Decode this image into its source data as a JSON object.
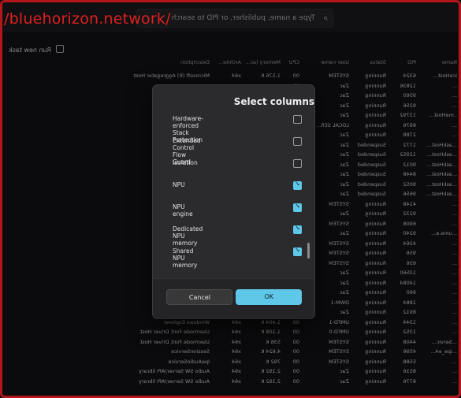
{
  "watermark": "/bluehorizon.network/",
  "search": {
    "placeholder": "Type a name, publisher, or PID to search"
  },
  "toolbar": {
    "run_new_task": "Run new task"
  },
  "columns": [
    "Name",
    "PID",
    "Status",
    "User name",
    "CPU",
    "Memory (ac...",
    "Archite...",
    "Description"
  ],
  "rows": [
    [
      "iceHost...",
      "6324",
      "Running",
      "SYSTEM",
      "00",
      "1,576 K",
      "x64",
      "Microsoft (R) Aggregator Host"
    ],
    [
      "...",
      "12836",
      "Running",
      "Zac",
      "00",
      "",
      "",
      ""
    ],
    [
      "...",
      "9560",
      "Running",
      "Zac",
      "00",
      "",
      "",
      ""
    ],
    [
      "...",
      "9256",
      "Running",
      "Zac",
      "00",
      "",
      "",
      ""
    ],
    [
      "..meHost...",
      "13792",
      "Running",
      "Zac",
      "00",
      "",
      "",
      ""
    ],
    [
      "...",
      "8976",
      "Running",
      "LOCAL SER...",
      "00",
      "",
      "",
      ""
    ],
    [
      "...",
      "2788",
      "Running",
      "Zac",
      "00",
      "",
      "",
      ""
    ],
    [
      "...askHost...",
      "1772",
      "Suspended",
      "Zac",
      "00",
      "",
      "",
      ""
    ],
    [
      "...askHost...",
      "12952",
      "Suspended",
      "Zac",
      "00",
      "",
      "",
      ""
    ],
    [
      "...askHost...",
      "9012",
      "Suspended",
      "Zac",
      "00",
      "",
      "",
      ""
    ],
    [
      "...askHost...",
      "8448",
      "Suspended",
      "Zac",
      "00",
      "",
      "",
      ""
    ],
    [
      "...askHost...",
      "9052",
      "Suspended",
      "Zac",
      "00",
      "",
      "",
      ""
    ],
    [
      "...askHost...",
      "9656",
      "Suspended",
      "Zac",
      "00",
      "",
      "",
      ""
    ],
    [
      "...",
      "4148",
      "Running",
      "SYSTEM",
      "00",
      "",
      "",
      ""
    ],
    [
      "...",
      "9232",
      "Running",
      "Zac",
      "00",
      "",
      "",
      ""
    ],
    [
      "...",
      "6908",
      "Running",
      "SYSTEM",
      "00",
      "",
      "",
      ""
    ],
    [
      "...ume.e...",
      "9240",
      "Running",
      "Zac",
      "00",
      "",
      "",
      ""
    ],
    [
      "...",
      "4264",
      "Running",
      "SYSTEM",
      "00",
      "",
      "",
      ""
    ],
    [
      "...",
      "956",
      "Running",
      "SYSTEM",
      "00",
      "",
      "",
      ""
    ],
    [
      "...",
      "656",
      "Running",
      "SYSTEM",
      "00",
      "",
      "",
      ""
    ],
    [
      "...",
      "13560",
      "Running",
      "Zac",
      "00",
      "",
      "",
      ""
    ],
    [
      "...",
      "14084",
      "Running",
      "Zac",
      "00",
      "",
      "",
      ""
    ],
    [
      "...",
      "960",
      "Running",
      "Zac",
      "00",
      "",
      "",
      ""
    ],
    [
      "...",
      "1884",
      "Running",
      "DWM-1",
      "00",
      "",
      "",
      ""
    ],
    [
      "...",
      "8912",
      "Running",
      "Zac",
      "00",
      "117,792 K",
      "x64",
      ""
    ],
    [
      "...",
      "1344",
      "Running",
      "UMFD-1",
      "00",
      "1,404 K",
      "x64",
      "Windows Explorer"
    ],
    [
      "...",
      "1352",
      "Running",
      "UMFD-0",
      "00",
      "1,108 K",
      "x64",
      "Usermode Font Driver Host"
    ],
    [
      "...Servic...",
      "4408",
      "Running",
      "SYSTEM",
      "00",
      "536 K",
      "x64",
      "Usermode Font Driver Host"
    ],
    [
      "...ipe_e4...",
      "4596",
      "Running",
      "SYSTEM",
      "00",
      "4,624 K",
      "x64",
      "SessionService"
    ],
    [
      "...",
      "5588",
      "Running",
      "SYSTEM",
      "00",
      "792 K",
      "x64",
      "IpeAudioService"
    ],
    [
      "...",
      "8516",
      "Running",
      "Zac",
      "00",
      "2,192 K",
      "x64",
      "Audio SW Server/API library"
    ],
    [
      "...",
      "8776",
      "Running",
      "Zac",
      "00",
      "2,192 K",
      "x64",
      "Audio SW Server/API library"
    ]
  ],
  "dialog": {
    "title": "Select columns",
    "options": [
      {
        "label": "Hardware-enforced Stack Protection",
        "checked": false
      },
      {
        "label": "Extended Control Flow Guard",
        "checked": false
      },
      {
        "label": "Isolation",
        "checked": false
      },
      {
        "label": "NPU",
        "checked": true
      },
      {
        "label": "NPU engine",
        "checked": true
      },
      {
        "label": "Dedicated NPU memory",
        "checked": true
      },
      {
        "label": "Shared NPU memory",
        "checked": true
      }
    ],
    "ok_label": "OK",
    "cancel_label": "Cancel"
  },
  "colors": {
    "accent": "#5fc7e8",
    "frame": "#b3161b",
    "watermark": "#e02020"
  }
}
